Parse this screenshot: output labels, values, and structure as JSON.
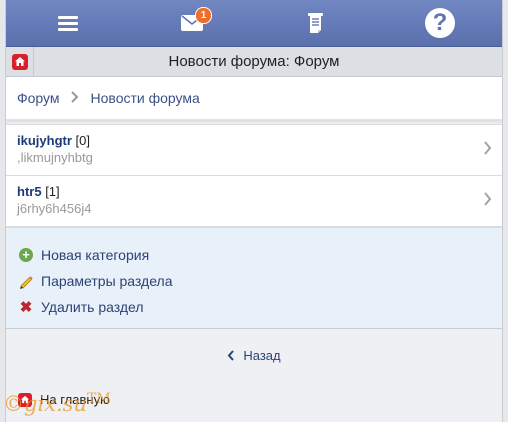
{
  "topbar": {
    "menu_icon": "hamburger-icon",
    "mail_icon": "mail-icon",
    "mail_badge": "1",
    "notes_icon": "notepad-icon",
    "help_icon": "question-icon",
    "help_glyph": "?"
  },
  "titlebar": {
    "title": "Новости форума: Форум",
    "home_icon": "home-icon"
  },
  "breadcrumb": {
    "items": [
      "Форум",
      "Новости форума"
    ],
    "separator": ">"
  },
  "topics": [
    {
      "name": "ikujyhgtr",
      "count": "[0]",
      "subtitle": ",likmujnyhbtg"
    },
    {
      "name": "htr5",
      "count": "[1]",
      "subtitle": "j6rhy6h456j4"
    }
  ],
  "actions": [
    {
      "label": "Новая категория",
      "icon": "plus-circle-icon"
    },
    {
      "label": "Параметры раздела",
      "icon": "pencil-icon"
    },
    {
      "label": "Удалить раздел",
      "icon": "delete-x-icon"
    }
  ],
  "back_label": "Назад",
  "footer": {
    "home_label": "На главную"
  },
  "watermark": "©gix.su",
  "watermark_tm": "TM",
  "colors": {
    "topbar": "#6075b2",
    "link": "#2d4275",
    "badge": "#ee6f2b",
    "home_red": "#d8202a"
  }
}
